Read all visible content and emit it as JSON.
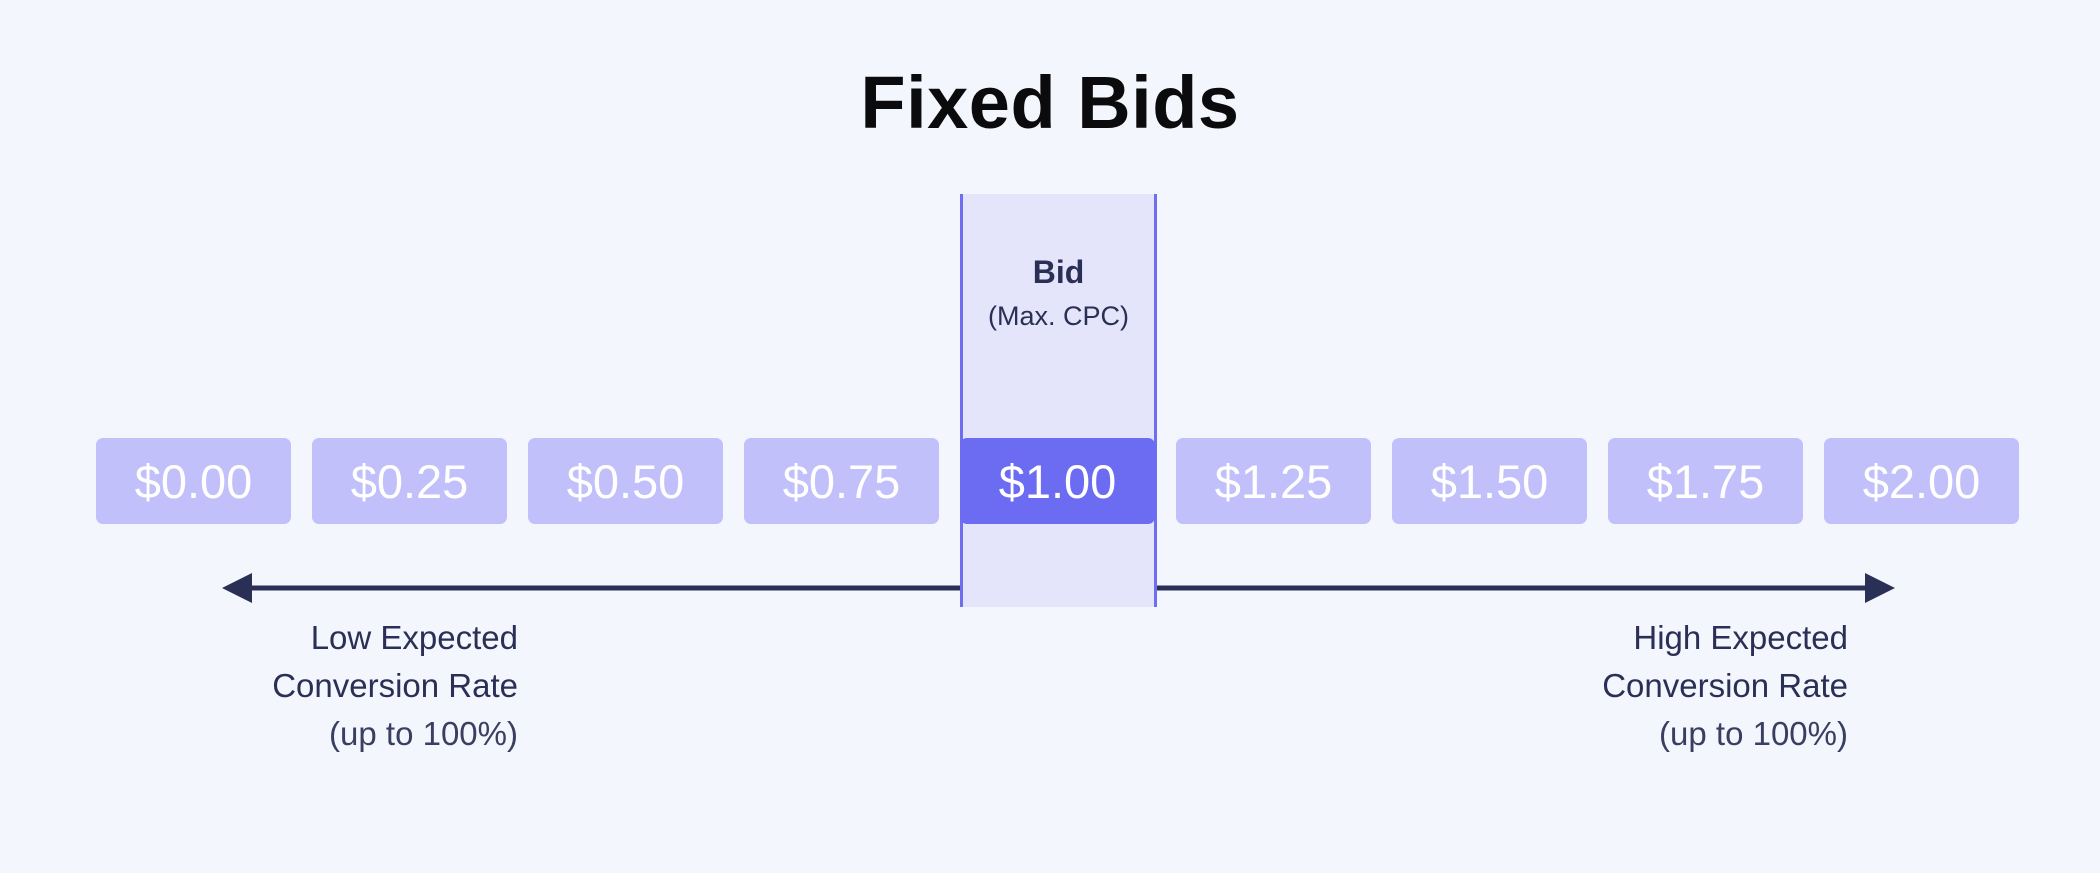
{
  "title": "Fixed Bids",
  "highlight": {
    "title": "Bid",
    "subtitle": "(Max. CPC)"
  },
  "bids": [
    {
      "label": "$0.00",
      "value": 0.0,
      "selected": false
    },
    {
      "label": "$0.25",
      "value": 0.25,
      "selected": false
    },
    {
      "label": "$0.50",
      "value": 0.5,
      "selected": false
    },
    {
      "label": "$0.75",
      "value": 0.75,
      "selected": false
    },
    {
      "label": "$1.00",
      "value": 1.0,
      "selected": true
    },
    {
      "label": "$1.25",
      "value": 1.25,
      "selected": false
    },
    {
      "label": "$1.50",
      "value": 1.5,
      "selected": false
    },
    {
      "label": "$1.75",
      "value": 1.75,
      "selected": false
    },
    {
      "label": "$2.00",
      "value": 2.0,
      "selected": false
    }
  ],
  "axis": {
    "left": {
      "line1": "Low Expected",
      "line2": "Conversion Rate",
      "line3": "(up to 100%)"
    },
    "right": {
      "line1": "High Expected",
      "line2": "Conversion Rate",
      "line3": "(up to 100%)"
    }
  },
  "colors": {
    "background": "#F3F6FD",
    "box": "#C1C0FA",
    "box_selected": "#6C6CF2",
    "highlight_fill": "#E4E5FB",
    "highlight_border": "#6E6EF0",
    "arrow": "#2A2F55",
    "title": "#0B0B0E"
  }
}
